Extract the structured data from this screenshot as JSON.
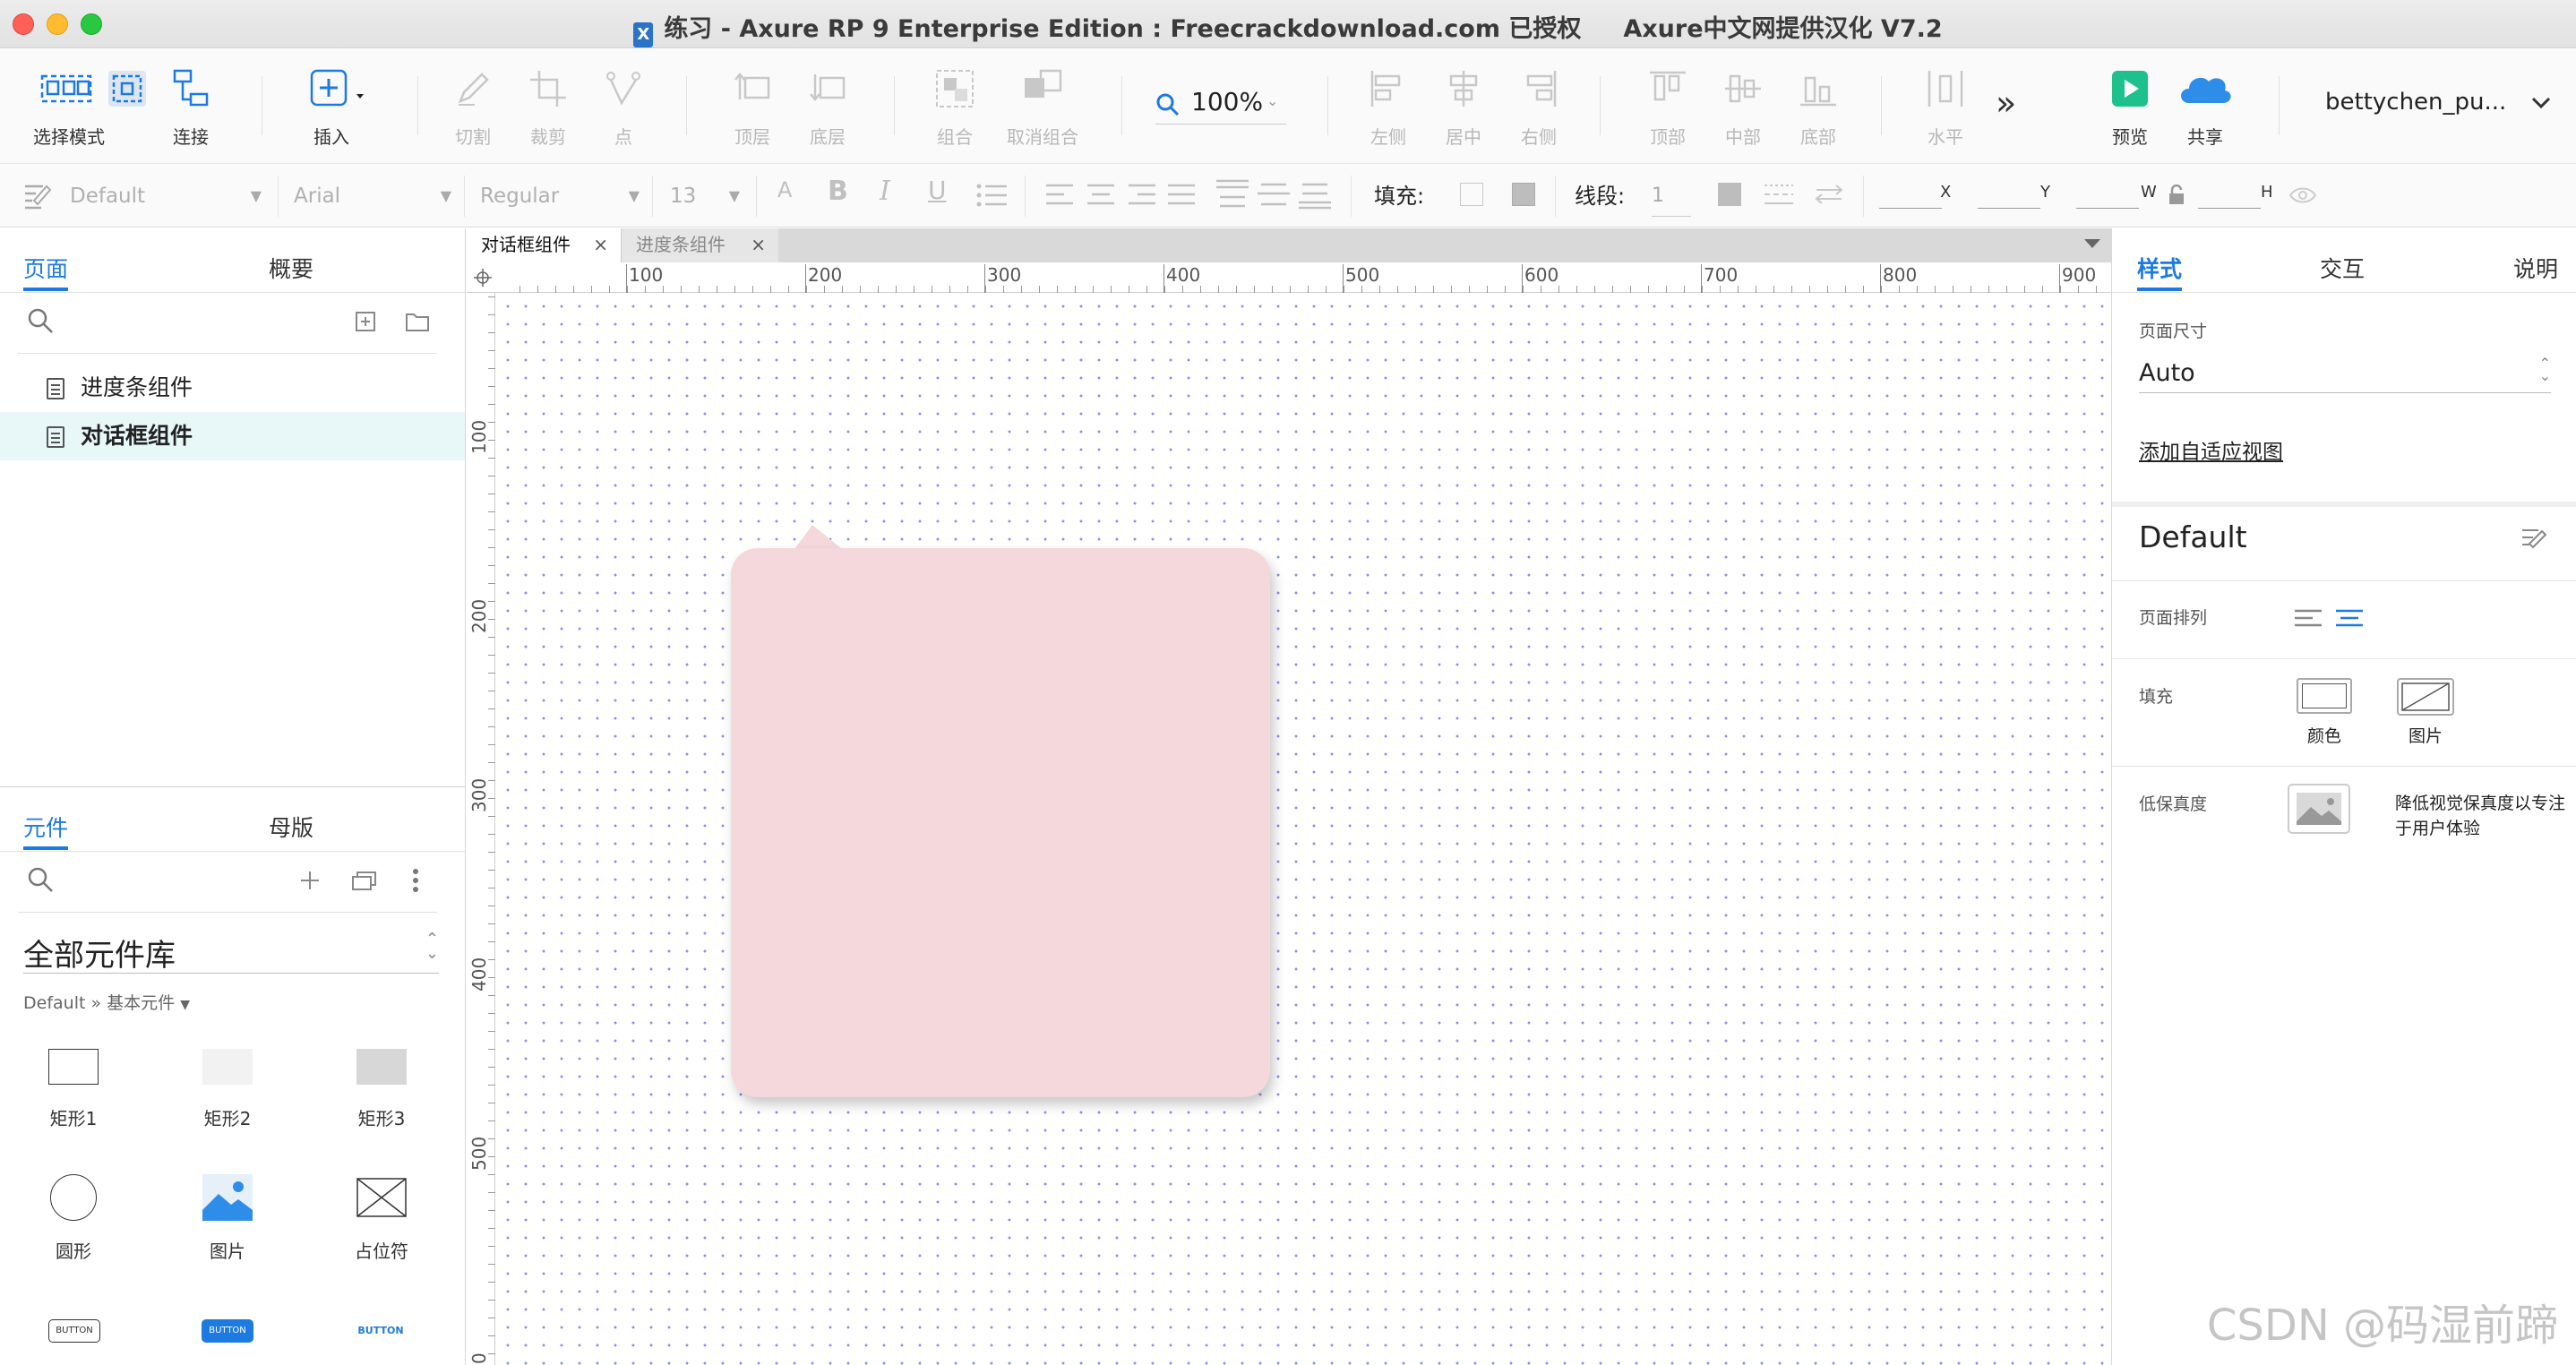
{
  "window": {
    "title": "练习 - Axure RP 9 Enterprise Edition : Freecrackdownload.com 已授权     Axure中文网提供汉化 V7.2",
    "app_icon_letter": "X"
  },
  "toolbar": {
    "select_mode": "选择模式",
    "connect": "连接",
    "insert": "插入",
    "cut": "切割",
    "crop": "裁剪",
    "point": "点",
    "top_layer": "顶层",
    "bottom_layer": "底层",
    "group": "组合",
    "ungroup": "取消组合",
    "zoom": "100%",
    "align_left": "左侧",
    "align_center": "居中",
    "align_right": "右侧",
    "align_top": "顶部",
    "align_middle": "中部",
    "align_bottom": "底部",
    "distribute_h": "水平",
    "more": "»",
    "preview": "预览",
    "share": "共享",
    "user": "bettychen_pu..."
  },
  "format_bar": {
    "style": "Default",
    "font": "Arial",
    "weight": "Regular",
    "size": "13",
    "fill_label": "填充:",
    "stroke_label": "线段:",
    "stroke_value": "1",
    "x_label": "X",
    "y_label": "Y",
    "w_label": "W",
    "h_label": "H"
  },
  "left_panel": {
    "tabs": [
      "页面",
      "概要"
    ],
    "pages": [
      {
        "name": "进度条组件",
        "selected": false
      },
      {
        "name": "对话框组件",
        "selected": true
      }
    ],
    "lib_tabs": [
      "元件",
      "母版"
    ],
    "library_name": "全部元件库",
    "breadcrumb": "Default » 基本元件",
    "breadcrumb_arrow": "▼",
    "widgets": [
      "矩形1",
      "矩形2",
      "矩形3",
      "圆形",
      "图片",
      "占位符"
    ],
    "button_widgets": [
      "BUTTON",
      "BUTTON",
      "BUTTON"
    ]
  },
  "canvas": {
    "tabs": [
      {
        "label": "对话框组件",
        "active": true
      },
      {
        "label": "进度条组件",
        "active": false
      }
    ],
    "ruler_top": [
      "100",
      "200",
      "300",
      "400",
      "500",
      "600",
      "700",
      "800",
      "900"
    ],
    "ruler_left": [
      "100",
      "200",
      "300",
      "400",
      "500",
      "0"
    ],
    "shape_fill": "#f5d8db"
  },
  "right_panel": {
    "tabs": [
      "样式",
      "交互",
      "说明"
    ],
    "page_size_label": "页面尺寸",
    "page_size_value": "Auto",
    "adaptive_link": "添加自适应视图",
    "style_name": "Default",
    "page_align_label": "页面排列",
    "fill_label": "填充",
    "fill_color": "颜色",
    "fill_image": "图片",
    "low_fidelity_label": "低保真度",
    "low_fidelity_desc": "降低视觉保真度以专注于用户体验"
  },
  "watermark": "CSDN @码湿前蹄",
  "colors": {
    "accent": "#1c7ae0",
    "preview_green": "#1ec08b",
    "share_blue": "#2d8de8"
  }
}
